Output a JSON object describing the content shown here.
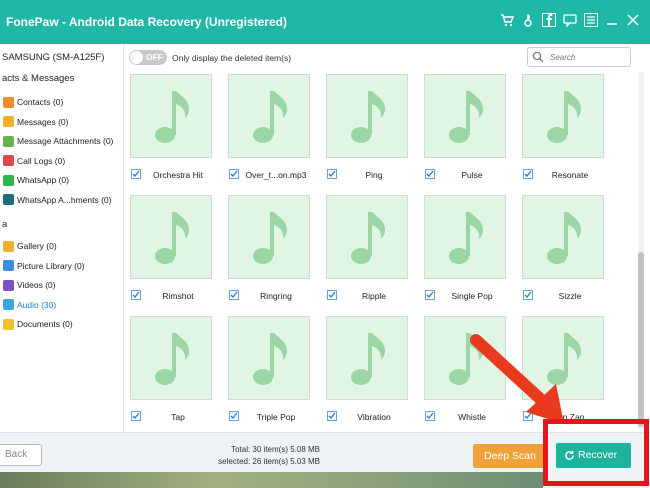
{
  "app": {
    "title": "FonePaw - Android Data Recovery (Unregistered)",
    "toolbar_icons": [
      "cart-icon",
      "key-icon",
      "facebook-icon",
      "chat-icon",
      "menu-icon",
      "minimize-icon",
      "close-icon"
    ]
  },
  "sidebar": {
    "device": "SAMSUNG (SM-A125F)",
    "section_contacts": "acts & Messages",
    "contacts_items": [
      {
        "label": "Contacts (0)",
        "color": "#f08c2a"
      },
      {
        "label": "Messages (0)",
        "color": "#f0b22a"
      },
      {
        "label": "Message Attachments (0)",
        "color": "#6ab24a"
      },
      {
        "label": "Call Logs (0)",
        "color": "#e04848"
      },
      {
        "label": "WhatsApp (0)",
        "color": "#2fb54a"
      },
      {
        "label": "WhatsApp A...hments (0)",
        "color": "#1f6e7a"
      }
    ],
    "section_media": "a",
    "media_items": [
      {
        "label": "Gallery (0)",
        "color": "#f2b02c"
      },
      {
        "label": "Picture Library (0)",
        "color": "#3a8fd8"
      },
      {
        "label": "Videos (0)",
        "color": "#7a4fc8"
      },
      {
        "label": "Audio (30)",
        "color": "#3aa6e8",
        "active": true
      },
      {
        "label": "Documents (0)",
        "color": "#f2c02c"
      }
    ]
  },
  "filter": {
    "toggle_text": "OFF",
    "label": "Only display the deleted item(s)",
    "search_placeholder": "Search"
  },
  "files": [
    {
      "name": "Orchestra Hit",
      "checked": true
    },
    {
      "name": "Over_t...on.mp3",
      "checked": true
    },
    {
      "name": "Ping",
      "checked": true
    },
    {
      "name": "Pulse",
      "checked": true
    },
    {
      "name": "Resonate",
      "checked": true
    },
    {
      "name": "Rimshot",
      "checked": true
    },
    {
      "name": "Ringring",
      "checked": true
    },
    {
      "name": "Ripple",
      "checked": true
    },
    {
      "name": "Single Pop",
      "checked": true
    },
    {
      "name": "Sizzle",
      "checked": true
    },
    {
      "name": "Tap",
      "checked": true
    },
    {
      "name": "Triple Pop",
      "checked": true
    },
    {
      "name": "Vibration",
      "checked": true
    },
    {
      "name": "Whistle",
      "checked": true
    },
    {
      "name": "Zip Zap",
      "checked": true
    }
  ],
  "footer": {
    "back_label": "Back",
    "total": "Total: 30 item(s) 5.08 MB",
    "selected": "selected: 26 item(s) 5.03 MB",
    "deep_scan_label": "Deep Scan",
    "recover_label": "Recover"
  },
  "colors": {
    "accent": "#1fb7a6",
    "deep_scan": "#f2a13a",
    "recover": "#1eb39a",
    "highlight": "#e8141b",
    "note_green": "#9bd6a4"
  }
}
